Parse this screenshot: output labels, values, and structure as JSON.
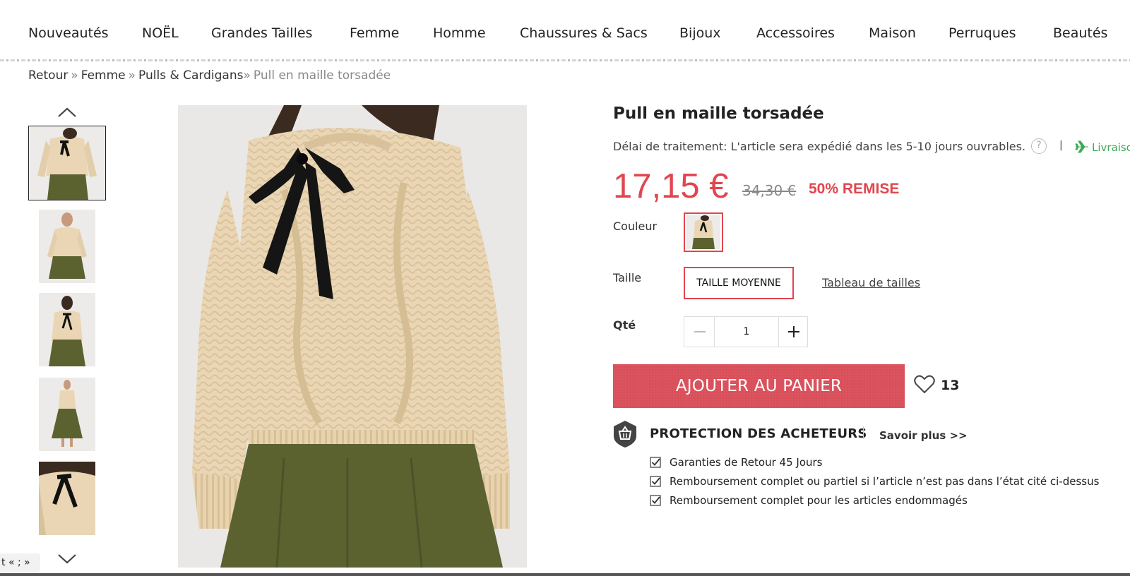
{
  "nav": {
    "items": [
      "Nouveautés",
      "NOËL",
      "Grandes Tailles",
      "Femme",
      "Homme",
      "Chaussures & Sacs",
      "Bijoux",
      "Accessoires",
      "Maison",
      "Perruques",
      "Beautés"
    ]
  },
  "breadcrumb": {
    "items": [
      "Retour",
      "Femme",
      "Pulls & Cardigans"
    ],
    "separator": "»",
    "current": "Pull en maille torsadée"
  },
  "gallery": {
    "up_icon": "chevron-up-icon",
    "down_icon": "chevron-down-icon",
    "thumbnail_count": 5,
    "active_thumbnail": 1
  },
  "product": {
    "title": "Pull en maille torsadée",
    "processing_time": "Délai de traitement: L'article sera expédié dans les 5-10 jours ouvrables.",
    "help_icon_text": "?",
    "pipe": "|",
    "shipping_link": "Livraison",
    "price": "17,15 €",
    "old_price": "34,30 €",
    "discount": "50% REMISE",
    "color_label": "Couleur",
    "size_label": "Taille",
    "size_value": "TAILLE MOYENNE",
    "size_chart_link": "Tableau de tailles",
    "qty_label": "Qté",
    "qty_value": "1",
    "add_to_cart": "AJOUTER AU PANIER",
    "favorite_count": "13"
  },
  "protection": {
    "title": "PROTECTION DES ACHETEURS",
    "learn_more": "Savoir plus >>",
    "items": [
      "Garanties de Retour 45 Jours",
      "Remboursement complet ou partiel si l’article n’est pas dans l’état cité ci-dessus",
      "Remboursement complet pour les articles endommagés"
    ]
  },
  "bottom_pill": "t « ; »",
  "colors": {
    "accent_red": "#e1464f",
    "button_red": "#d9505b",
    "shipping_green": "#3aaa55",
    "sweater_beige": "#ead6b4",
    "skirt_olive": "#5b6230"
  }
}
